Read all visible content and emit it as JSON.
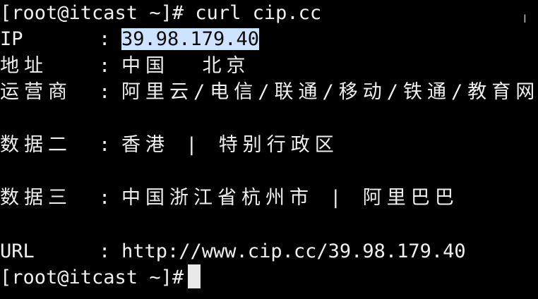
{
  "terminal": {
    "prompt": "[root@itcast ~]#",
    "command": " curl cip.cc",
    "fields": [
      {
        "key": "IP",
        "value": "39.98.179.40",
        "highlighted": true
      },
      {
        "key": "地址",
        "value": "中国  北京"
      },
      {
        "key": "运营商",
        "value": "阿里云/电信/联通/移动/铁通/教育网"
      },
      {
        "key": "数据二",
        "value": "香港 | 特别行政区"
      },
      {
        "key": "数据三",
        "value": "中国浙江省杭州市 | 阿里巴巴"
      },
      {
        "key": "URL",
        "value": "http://www.cip.cc/39.98.179.40"
      }
    ],
    "separator": ":",
    "prompt_end": "[root@itcast ~]#"
  },
  "colors": {
    "background": "#000000",
    "foreground": "#f0f0f0",
    "selection": "#cde3ff"
  },
  "icons": {
    "mouse_cursor": "i-beam-cursor-icon"
  }
}
